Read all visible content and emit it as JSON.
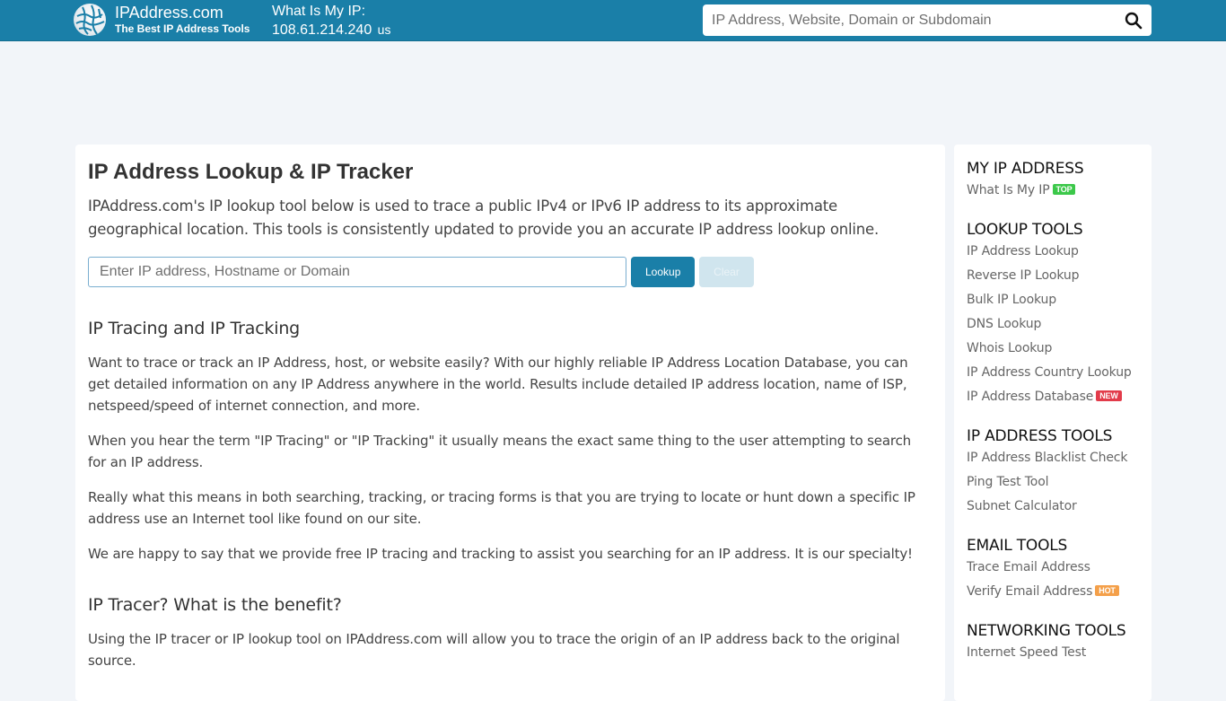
{
  "header": {
    "logo_title": "IPAddress.com",
    "logo_subtitle": "The Best IP Address Tools",
    "myip_label": "What Is My IP:",
    "myip_value": "108.61.214.240",
    "myip_country": "us",
    "search_placeholder": "IP Address, Website, Domain or Subdomain",
    "search_icon": "search-icon"
  },
  "main": {
    "title": "IP Address Lookup & IP Tracker",
    "intro": "IPAddress.com's IP lookup tool below is used to trace a public IPv4 or IPv6 IP address to its approximate geographical location. This tools is consistently updated to provide you an accurate IP address lookup online.",
    "lookup_placeholder": "Enter IP address, Hostname or Domain",
    "lookup_value": "",
    "lookup_button": "Lookup",
    "clear_button": "Clear",
    "section1_title": "IP Tracing and IP Tracking",
    "section1_paragraphs": [
      "Want to trace or track an IP Address, host, or website easily? With our highly reliable IP Address Location Database, you can get detailed information on any IP Address anywhere in the world. Results include detailed IP address location, name of ISP, netspeed/speed of internet connection, and more.",
      "When you hear the term \"IP Tracing\" or \"IP Tracking\" it usually means the exact same thing to the user attempting to search for an IP address.",
      "Really what this means in both searching, tracking, or tracing forms is that you are trying to locate or hunt down a specific IP address use an Internet tool like found on our site.",
      "We are happy to say that we provide free IP tracing and tracking to assist you searching for an IP address. It is our specialty!"
    ],
    "section2_title": "IP Tracer? What is the benefit?",
    "section2_paragraphs": [
      "Using the IP tracer or IP lookup tool on IPAddress.com will allow you to trace the origin of an IP address back to the original source."
    ]
  },
  "sidebar": {
    "groups": [
      {
        "title": "MY IP ADDRESS",
        "items": [
          {
            "label": "What Is My IP",
            "badge": "TOP"
          }
        ]
      },
      {
        "title": "LOOKUP TOOLS",
        "items": [
          {
            "label": "IP Address Lookup"
          },
          {
            "label": "Reverse IP Lookup"
          },
          {
            "label": "Bulk IP Lookup"
          },
          {
            "label": "DNS Lookup"
          },
          {
            "label": "Whois Lookup"
          },
          {
            "label": "IP Address Country Lookup"
          },
          {
            "label": "IP Address Database",
            "badge": "NEW"
          }
        ]
      },
      {
        "title": "IP ADDRESS TOOLS",
        "items": [
          {
            "label": "IP Address Blacklist Check"
          },
          {
            "label": "Ping Test Tool"
          },
          {
            "label": "Subnet Calculator"
          }
        ]
      },
      {
        "title": "EMAIL TOOLS",
        "items": [
          {
            "label": "Trace Email Address"
          },
          {
            "label": "Verify Email Address",
            "badge": "HOT"
          }
        ]
      },
      {
        "title": "NETWORKING TOOLS",
        "items": [
          {
            "label": "Internet Speed Test"
          }
        ]
      }
    ]
  },
  "colors": {
    "brand": "#1a7fa8",
    "badge_top": "#3cc84a",
    "badge_new": "#e23b4a",
    "badge_hot": "#f4a04a"
  }
}
